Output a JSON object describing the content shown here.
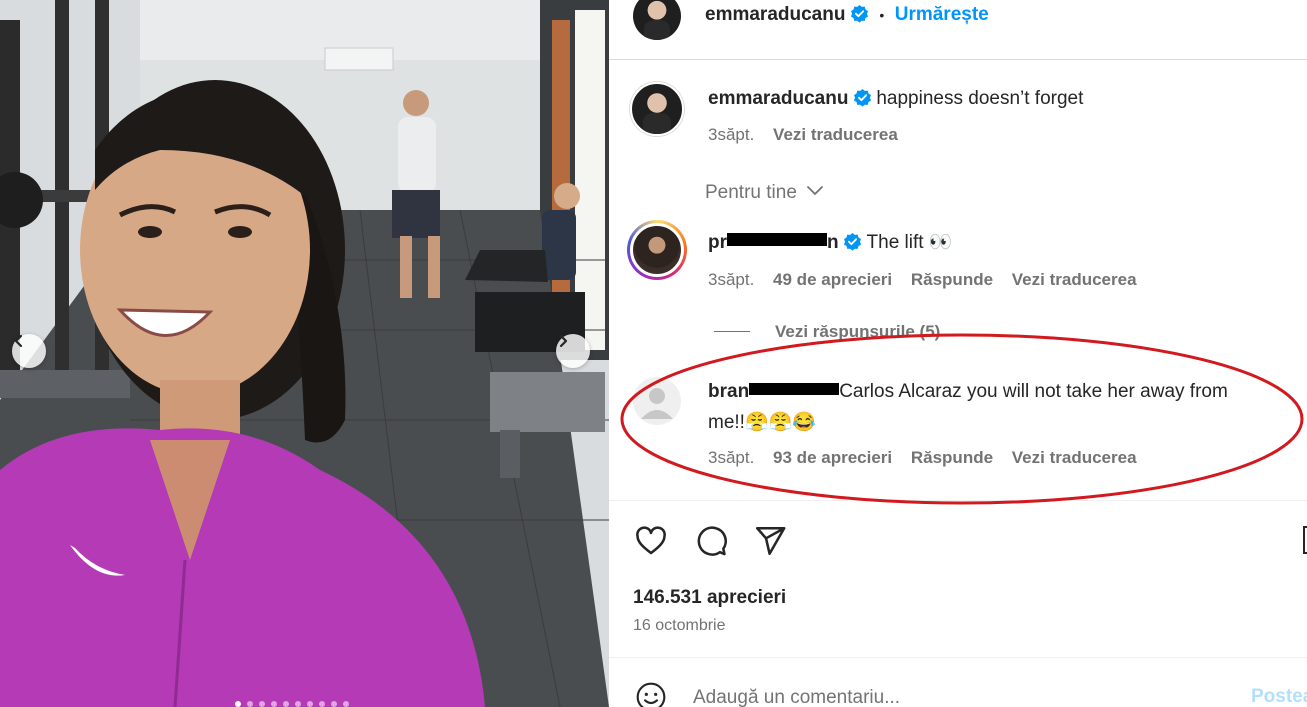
{
  "header": {
    "username": "emmaraducanu",
    "separator": "•",
    "follow_label": "Urmărește"
  },
  "caption": {
    "username": "emmaraducanu",
    "text": "happiness doesn’t forget",
    "time": "3săpt.",
    "translate_label": "Vezi traducerea"
  },
  "sort_label": "Pentru tine",
  "comments": [
    {
      "username_visible": "pr",
      "username_tail": "n",
      "text": "The lift 👀",
      "time": "3săpt.",
      "likes": "49 de aprecieri",
      "reply_label": "Răspunde",
      "translate_label": "Vezi traducerea",
      "view_replies_label": "Vezi răspunsurile (5)"
    },
    {
      "username_visible": "bran",
      "username_tail": "",
      "text_line1": "Carlos Alcaraz you will not take her away from",
      "text_line2": "me!!😤😤😂",
      "time": "3săpt.",
      "likes": "93 de aprecieri",
      "reply_label": "Răspunde",
      "translate_label": "Vezi traducerea"
    }
  ],
  "likes_count": "146.531 aprecieri",
  "post_date": "16 octombrie",
  "comment_box": {
    "placeholder": "Adaugă un comentariu...",
    "post_label": "Postează"
  },
  "icons": {
    "like": "heart-icon",
    "comment": "speech-bubble-icon",
    "share": "paper-plane-icon",
    "emoji": "smiley-icon",
    "verified": "verified-badge-icon",
    "chevron": "chevron-down-icon"
  },
  "colors": {
    "link_blue": "#0095f6",
    "verified_blue": "#0095f6",
    "muted_text": "#737373",
    "annotation_red": "#d11a1f",
    "jacket_magenta": "#b43ab6"
  },
  "carousel": {
    "slides": 10,
    "active_index": 0
  }
}
